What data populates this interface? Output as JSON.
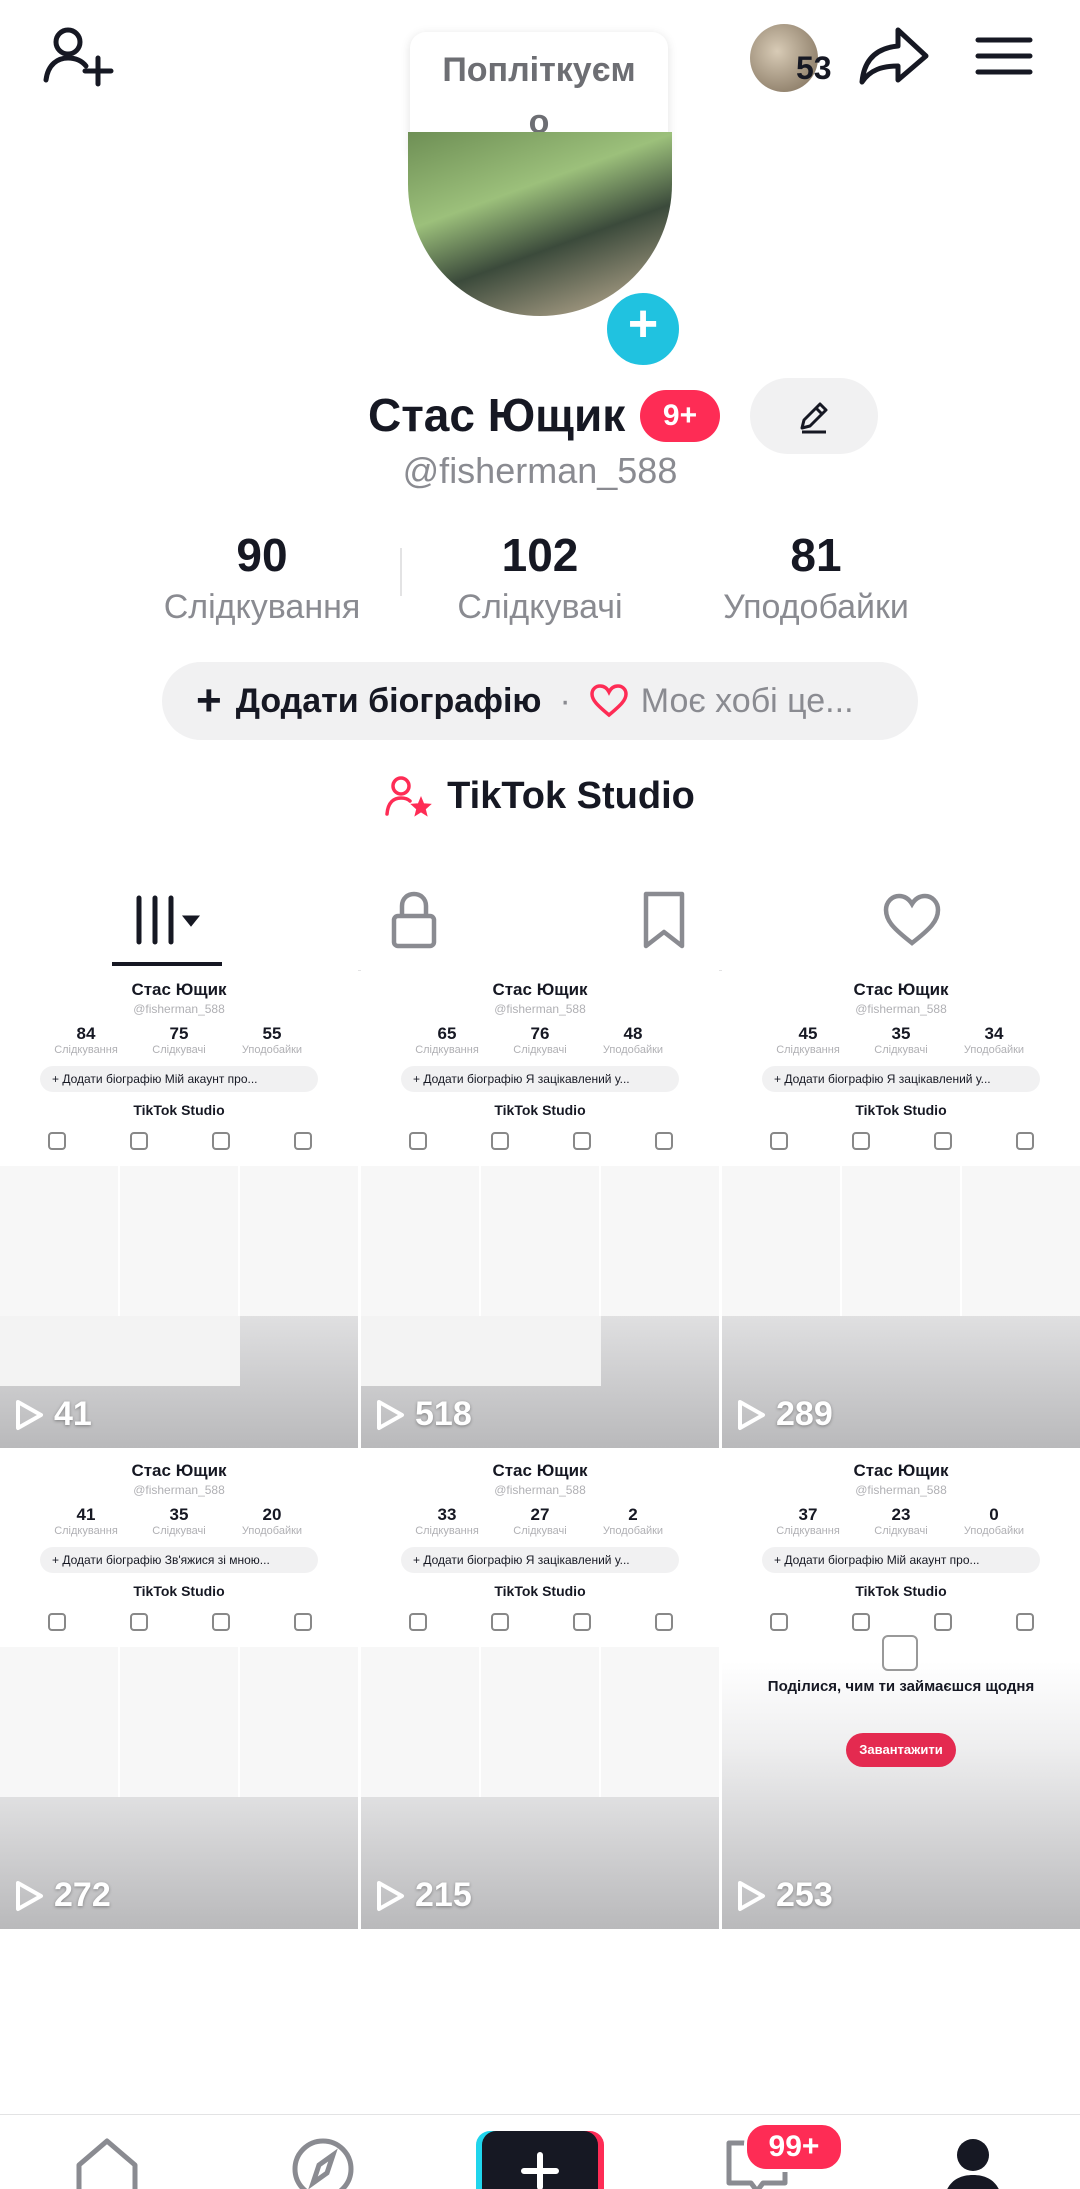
{
  "top": {
    "follower_avatar_count": "53",
    "note_bubble": "Попліткуємо",
    "note_line1": "Попліткуєм",
    "note_line2": "о",
    "icons": [
      "add-friend-icon",
      "share-icon",
      "menu-icon"
    ]
  },
  "profile": {
    "display_name": "Стас Ющик",
    "name_badge": "9+",
    "username": "@fisherman_588",
    "stats": [
      {
        "value": "90",
        "label": "Слідкування"
      },
      {
        "value": "102",
        "label": "Слідкувачі"
      },
      {
        "value": "81",
        "label": "Уподобайки"
      }
    ],
    "bio_add_label": "Додати біографію",
    "bio_separator": "·",
    "bio_hobby": "Моє хобі це...",
    "studio_label": "TikTok Studio"
  },
  "tabs": [
    {
      "name": "videos",
      "icon": "videos-grid-icon",
      "active": true
    },
    {
      "name": "private",
      "icon": "lock-icon"
    },
    {
      "name": "favorites",
      "icon": "bookmark-icon"
    },
    {
      "name": "liked",
      "icon": "heart-icon"
    }
  ],
  "videos": [
    {
      "views": "41",
      "mini_stats": [
        "84",
        "75",
        "55"
      ],
      "mini_bio": "+ Додати біографію   Мій акаунт про...",
      "empty": false
    },
    {
      "views": "518",
      "mini_stats": [
        "65",
        "76",
        "48"
      ],
      "mini_bio": "+ Додати біографію   Я зацікавлений у...",
      "empty": false
    },
    {
      "views": "289",
      "mini_stats": [
        "45",
        "35",
        "34"
      ],
      "mini_bio": "+ Додати біографію   Я зацікавлений у...",
      "empty": false
    },
    {
      "views": "272",
      "mini_stats": [
        "41",
        "35",
        "20"
      ],
      "mini_bio": "+ Додати біографію   Зв'яжися зі мною...",
      "empty": false
    },
    {
      "views": "215",
      "mini_stats": [
        "33",
        "27",
        "2"
      ],
      "mini_bio": "+ Додати біографію   Я зацікавлений у...",
      "empty": false
    },
    {
      "views": "253",
      "mini_stats": [
        "37",
        "23",
        "0"
      ],
      "mini_bio": "+ Додати біографію   Мій акаунт про...",
      "empty": true,
      "empty_text": "Поділися, чим ти займаєшся щодня",
      "empty_button": "Завантажити"
    }
  ],
  "mini_labels": {
    "name": "Стас Ющик",
    "handle": "@fisherman_588",
    "stat_labels": [
      "Слідкування",
      "Слідкувачі",
      "Уподобайки"
    ],
    "studio": "TikTok Studio"
  },
  "bottom_nav": {
    "items": [
      "home-icon",
      "discover-icon",
      "create-icon",
      "inbox-icon",
      "profile-icon"
    ],
    "inbox_badge": "99+"
  },
  "colors": {
    "accent_red": "#fe2c55",
    "accent_cyan": "#20d5ec",
    "text_primary": "#161823",
    "text_secondary": "#8a8b91"
  }
}
